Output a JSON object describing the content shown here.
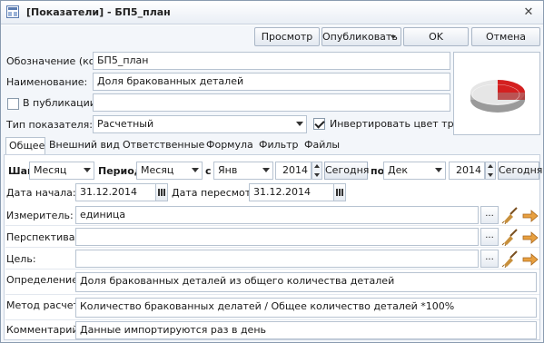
{
  "window": {
    "title": "[Показатели] - БП5_план",
    "close_glyph": "✕"
  },
  "toolbar": {
    "preview": "Просмотр",
    "publish": "Опубликовать",
    "ok": "OK",
    "cancel": "Отмена"
  },
  "form": {
    "code_label": "Обозначение (код):",
    "code_value": "БП5_план",
    "name_label": "Наименование:",
    "name_value": "Доля бракованных деталей",
    "publish_label": "В публикации:",
    "publish_checked": false,
    "publish_value": "",
    "type_label": "Тип показателя:",
    "type_value": "Расчетный",
    "invert_label": "Инвертировать цвет тренда",
    "invert_checked": true
  },
  "tabs": [
    "Общее",
    "Внешний вид",
    "Ответственные",
    "Формула",
    "Фильтр",
    "Файлы"
  ],
  "general": {
    "step_label": "Шаг:",
    "step_value": "Месяц",
    "period_label": "Период:",
    "period_value": "Месяц",
    "from_label": "с",
    "from_month": "Янв",
    "from_year": "2014",
    "today_from": "Сегодня",
    "to_label": "по",
    "to_month": "Дек",
    "to_year": "2014",
    "today_to": "Сегодня",
    "start_label": "Дата начала:",
    "start_value": "31.12.2014",
    "review_label": "Дата пересмотра:",
    "review_value": "31.12.2014",
    "unit_label": "Измеритель:",
    "unit_value": "единица",
    "perspective_label": "Перспектива:",
    "perspective_value": "",
    "goal_label": "Цель:",
    "goal_value": "",
    "definition_label": "Определение:",
    "definition_value": "Доля бракованных деталей из общего количества деталей",
    "method_label": "Метод расчета:",
    "method_value": "Количество бракованных делатей / Общее количество деталей *100%",
    "comment_label": "Комментарий:",
    "comment_value": "Данные импортируются раз в день",
    "ellipsis": "..."
  },
  "colors": {
    "accent_red": "#d42020",
    "border": "#b7c3d1",
    "background": "#f3f6fa"
  },
  "icons": [
    "window-app-icon",
    "close-icon",
    "dropdown-arrow-icon",
    "pie-chart-icon",
    "calendar-icon",
    "broom-clear-icon",
    "arrow-select-icon"
  ]
}
